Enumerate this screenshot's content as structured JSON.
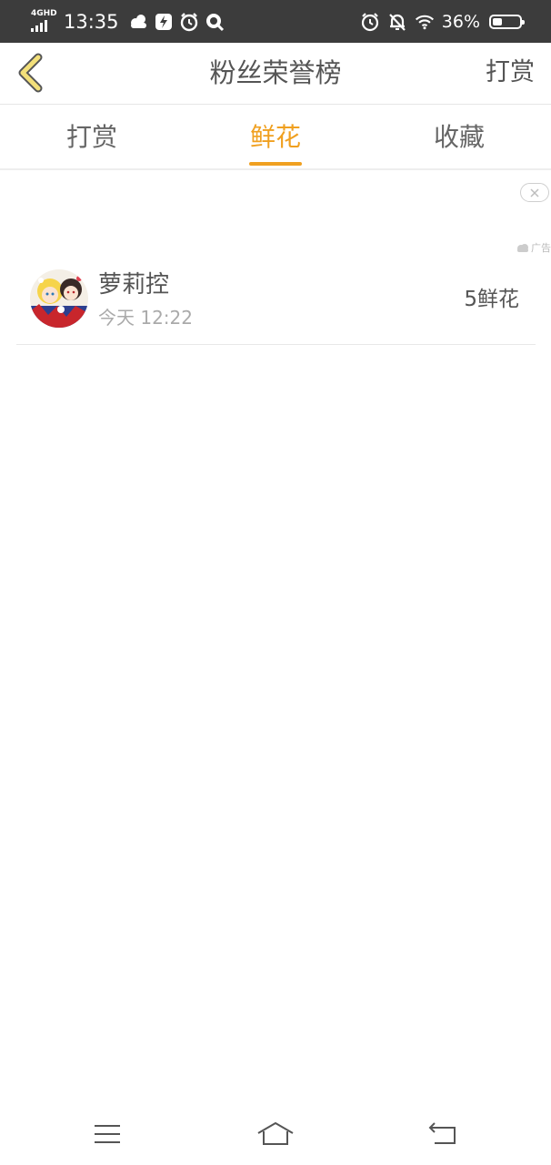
{
  "status_bar": {
    "network": "4GHD",
    "time": "13:35",
    "battery": "36%",
    "battery_level": 0.36,
    "left_icons": [
      "cloud-icon",
      "flash-icon",
      "alarm-icon",
      "q-app-icon"
    ],
    "right_icons": [
      "alarm-icon",
      "mute-bell-icon",
      "wifi-icon"
    ]
  },
  "header": {
    "title": "粉丝荣誉榜",
    "right_action": "打赏",
    "back_icon": "chevron-left-icon",
    "accent_color": "#f0a020"
  },
  "tabs": [
    {
      "label": "打赏",
      "active": false
    },
    {
      "label": "鲜花",
      "active": true
    },
    {
      "label": "收藏",
      "active": false
    }
  ],
  "ad": {
    "label": "广告",
    "close_icon": "close-icon"
  },
  "fans": [
    {
      "name": "萝莉控",
      "time": "今天 12:22",
      "gift": "5鲜花",
      "avatar_icon": "avatar-anime-image"
    }
  ],
  "nav_bar": {
    "items": [
      "menu-icon",
      "home-icon",
      "back-icon"
    ]
  }
}
